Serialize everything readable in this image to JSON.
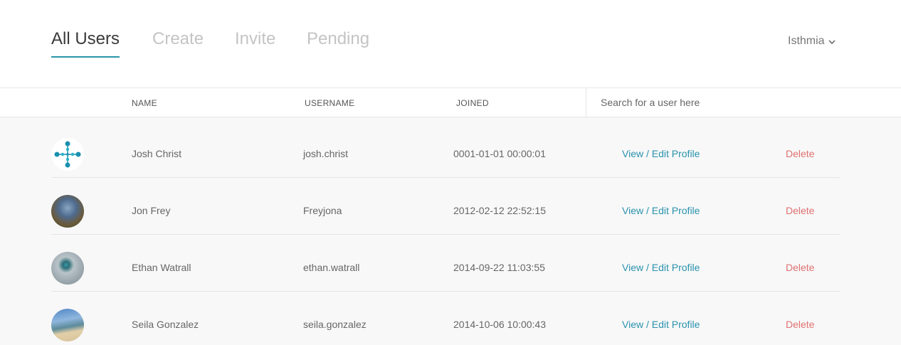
{
  "tabs": [
    "All Users",
    "Create",
    "Invite",
    "Pending"
  ],
  "org_selector": "Isthmia",
  "columns": {
    "name": "NAME",
    "username": "USERNAME",
    "joined": "JOINED"
  },
  "search": {
    "placeholder": "Search for a user here"
  },
  "users": [
    {
      "name": "Josh Christ",
      "username": "josh.christ",
      "joined": "0001-01-01 00:00:01",
      "view": "View / Edit Profile",
      "delete": "Delete"
    },
    {
      "name": "Jon Frey",
      "username": "Freyjona",
      "joined": "2012-02-12 22:52:15",
      "view": "View / Edit Profile",
      "delete": "Delete"
    },
    {
      "name": "Ethan Watrall",
      "username": "ethan.watrall",
      "joined": "2014-09-22 11:03:55",
      "view": "View / Edit Profile",
      "delete": "Delete"
    },
    {
      "name": "Seila Gonzalez",
      "username": "seila.gonzalez",
      "joined": "2014-10-06 10:00:43",
      "view": "View / Edit Profile",
      "delete": "Delete"
    }
  ],
  "colors": {
    "accent": "#2a96a8",
    "link": "#2a92ad",
    "danger": "#e07070"
  }
}
